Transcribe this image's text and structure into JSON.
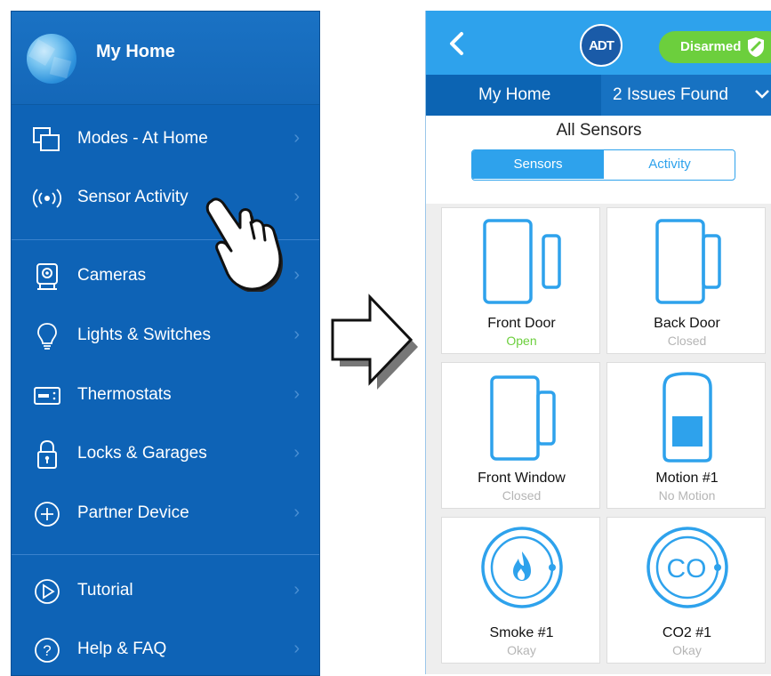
{
  "left_menu": {
    "title": "My Home",
    "items": [
      {
        "label": "Modes - At Home",
        "icon": "modes-icon"
      },
      {
        "label": "Sensor Activity",
        "icon": "sensor-activity-icon"
      },
      {
        "label": "Cameras",
        "icon": "camera-icon"
      },
      {
        "label": "Lights & Switches",
        "icon": "lightbulb-icon"
      },
      {
        "label": "Thermostats",
        "icon": "thermostat-icon"
      },
      {
        "label": "Locks & Garages",
        "icon": "lock-icon"
      },
      {
        "label": "Partner Device",
        "icon": "plus-circle-icon"
      },
      {
        "label": "Tutorial",
        "icon": "play-circle-icon"
      },
      {
        "label": "Help & FAQ",
        "icon": "help-circle-icon"
      }
    ]
  },
  "right_app": {
    "logo": "ADT",
    "status": "Disarmed",
    "location": "My Home",
    "issues": "2 Issues Found",
    "page_title": "All Sensors",
    "tabs": [
      "Sensors",
      "Activity"
    ],
    "selected_tab": "Sensors",
    "sensors": [
      {
        "name": "Front Door",
        "state": "Open",
        "type": "door-sensor-icon"
      },
      {
        "name": "Back Door",
        "state": "Closed",
        "type": "door-sensor-icon"
      },
      {
        "name": "Front Window",
        "state": "Closed",
        "type": "window-sensor-icon"
      },
      {
        "name": "Motion #1",
        "state": "No Motion",
        "type": "motion-sensor-icon"
      },
      {
        "name": "Smoke #1",
        "state": "Okay",
        "type": "smoke-detector-icon"
      },
      {
        "name": "CO2 #1",
        "state": "Okay",
        "type": "co-detector-icon"
      }
    ],
    "co_symbol": "CO"
  },
  "colors": {
    "menu_bg": "#0e63b6",
    "app_blue": "#2ea2ec",
    "subbar_blue": "#0c64b3",
    "disarmed_green": "#6ccf3d",
    "open_green": "#6ccf3d"
  }
}
